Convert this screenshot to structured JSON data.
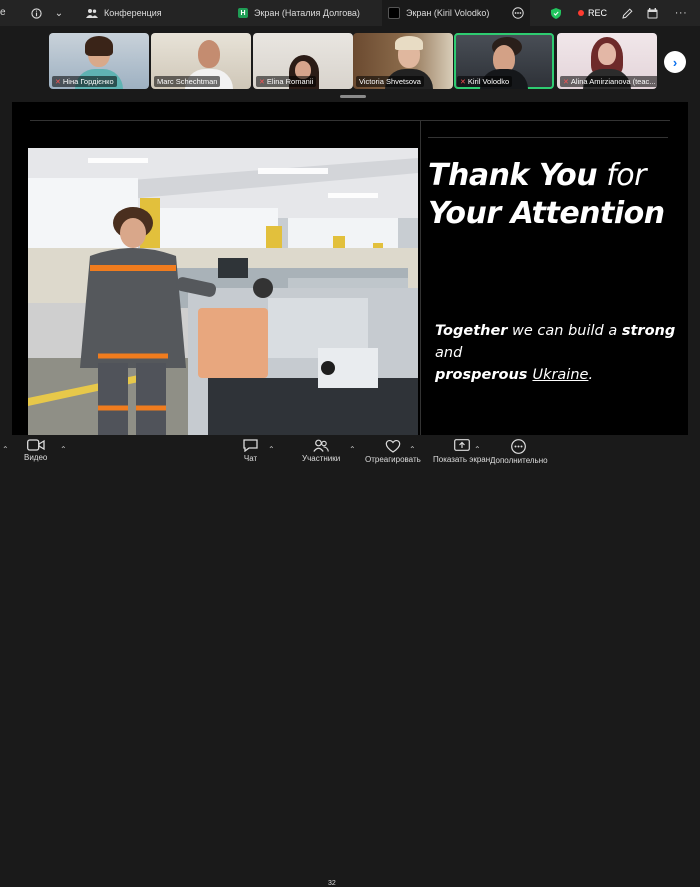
{
  "tabs": {
    "left_fragment": "e",
    "conference_label": "Конференция",
    "screen1_label": "Экран (Наталия Долгова)",
    "screen1_badge": "H",
    "screen2_label": "Экран (Kiril Volodko)"
  },
  "top_controls": {
    "rec_label": "REC"
  },
  "participants": [
    {
      "name": "Ніна Гордієнко",
      "muted": true
    },
    {
      "name": "Marc Schechtman",
      "muted": false
    },
    {
      "name": "Elina Romanii",
      "muted": true
    },
    {
      "name": "Victoria Shvetsova",
      "muted": false
    },
    {
      "name": "Kiril Volodko",
      "muted": true,
      "speaking": true
    },
    {
      "name": "Alina Amirzianova (teac...",
      "muted": true
    }
  ],
  "slide": {
    "thank_strong": "Thank You",
    "thank_for": " for",
    "thank_line2": "Your Attention",
    "together_1": "Together",
    "together_2": " we can build a ",
    "together_3": "strong",
    "together_4": " and",
    "together_5": "prosperous ",
    "together_6": "Ukraine",
    "together_7": "."
  },
  "toolbar": {
    "video_label": "Видео",
    "chat_label": "Чат",
    "participants_label": "Участники",
    "participants_count": "32",
    "reactions_label": "Отреагировать",
    "share_label": "Показать экран",
    "more_label": "Дополнительно"
  },
  "colors": {
    "accent_blue": "#0e72ed",
    "speaking_green": "#2ecc71",
    "rec_red": "#ff3b30",
    "shield_green": "#22c55e"
  }
}
